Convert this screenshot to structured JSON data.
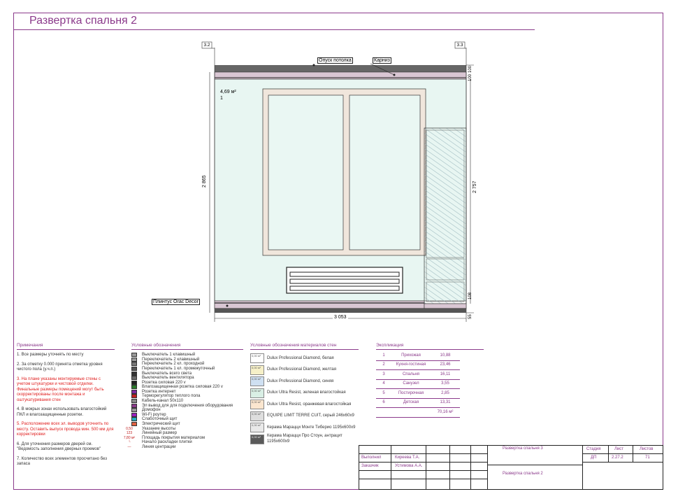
{
  "title": "Развертка спальня 2",
  "drawing": {
    "axis_left": "3.2",
    "axis_right": "3.3",
    "label_ceiling": "Опуск потолка",
    "label_cornice": "Карниз",
    "label_plinth": "Плинтус Orac Decor",
    "area": "4,69 м²",
    "area_index": "1",
    "dim_height": "2 865",
    "dim_width": "3 053",
    "dim_right_height": "2 757",
    "dim_top_100": "100",
    "dim_top_100b": "100",
    "dim_108": "108",
    "dim_55": "55",
    "colors": {
      "wall": "#e8f6f2",
      "band": "#d9c6d3",
      "frame": "#f0e6dc",
      "accent": "#8b3a8b"
    }
  },
  "notes": {
    "heading": "Примечания",
    "items": [
      {
        "text": "1. Все размеры уточнять по месту",
        "red": false
      },
      {
        "text": "2. За отметку 0.000 принята отметка уровня чистого пола  (у.ч.п.)",
        "red": false
      },
      {
        "text": "3. На плане указаны монтируемые стены с учетом штукатурки и чистовой отделки. Финальные размеры помещений могут быть скорректированы после монтажа и оштукатуривания стен",
        "red": true
      },
      {
        "text": "4. В мокрых зонах использовать влагостойкий ПКЛ и влагозащищенные розетки.",
        "red": false
      },
      {
        "text": "5. Расположение всех эл. выводов уточнить по месту. Оставить выпуск провода мин. 500 мм для корректировки",
        "red": true
      },
      {
        "text": "6. Для уточнения размеров дверей см. \"Ведомость заполнения дверных проемов\"",
        "red": false
      },
      {
        "text": "7. Количество всех элементов просчитано без запаса",
        "red": false
      }
    ]
  },
  "legend": {
    "heading": "Условные обозначения",
    "items": [
      {
        "label": "Выключатель 1 клавишный",
        "icon": "switch-1-icon",
        "color": "#999"
      },
      {
        "label": "Переключатель 2 клавишный",
        "icon": "switch-2-icon",
        "color": "#999"
      },
      {
        "label": "Переключатель 2 кл. проходной",
        "icon": "switch-pass-icon",
        "color": "#777"
      },
      {
        "label": "Переключатель 1 кл. промежуточный",
        "icon": "switch-mid-icon",
        "color": "#555"
      },
      {
        "label": "Выключатель всего света",
        "icon": "switch-all-icon",
        "color": "#333"
      },
      {
        "label": "Выключатель вентилятора",
        "icon": "fan-switch-icon",
        "color": "#666"
      },
      {
        "label": "Розетка силовая 220 v",
        "icon": "socket-icon",
        "color": "#222"
      },
      {
        "label": "Влагозащищенная розетка силовая 220 v",
        "icon": "wet-socket-icon",
        "color": "#2a7a2a"
      },
      {
        "label": "Розетка интернет",
        "icon": "lan-socket-icon",
        "color": "#7a2aa0"
      },
      {
        "label": "Терморегулятор теплого пола",
        "icon": "thermostat-icon",
        "color": "#c02020"
      },
      {
        "label": "Кабель-канал 50х110",
        "icon": "cable-channel-icon",
        "color": "#888"
      },
      {
        "label": "Эл вывод для для подключения оборудования",
        "icon": "power-outlet-icon",
        "color": "#8b3a8b"
      },
      {
        "label": "Домофон",
        "icon": "intercom-icon",
        "color": "#999"
      },
      {
        "label": "Wi-Fi роутер",
        "icon": "wifi-router-icon",
        "color": "#9a20c0"
      },
      {
        "label": "Слаботочный щит",
        "icon": "lowcurrent-panel-icon",
        "color": "#20b0c0"
      },
      {
        "label": "Электрический щит",
        "icon": "electric-panel-icon",
        "color": "#e06040"
      },
      {
        "label": "Указание высоты",
        "icon": "height-mark-icon",
        "color": "#c02020"
      },
      {
        "label": "Линейный размер",
        "icon": "linear-dim-icon",
        "color": "#c02020"
      },
      {
        "label": "Площадь покрытия материалом",
        "icon": "area-mark-icon",
        "color": "#c02020"
      },
      {
        "label": "Начало раскладки плитки",
        "icon": "tile-start-icon",
        "color": "#c02020"
      },
      {
        "label": "Линия центрации",
        "icon": "center-line-icon",
        "color": "#c02020"
      }
    ],
    "marks": {
      "h": "0,50",
      "dim": "123",
      "area": "7,80 м²"
    }
  },
  "materials": {
    "heading": "Условные обозначения материалов стен",
    "items": [
      {
        "label": "Dulux Professional Diamond, белая",
        "tag": "0,00 м²",
        "color": "#ffffff"
      },
      {
        "label": "Dulux Professional Diamond, желтая",
        "tag": "0,00 м²",
        "color": "#f6f0c8"
      },
      {
        "label": "Dulux Professional Diamond, синяя",
        "tag": "0,00 м²",
        "color": "#cfe0f2"
      },
      {
        "label": "Dulux Ultra Resist, зеленая влагостойкая",
        "tag": "0,00 м²",
        "color": "#d9efe5"
      },
      {
        "label": "Dulux Ultra Resist, оранжевая влагостойкая",
        "tag": "0,00 м²",
        "color": "#fbe6cf"
      },
      {
        "label": "EQUIPE LIMIT TERRE CUIT, серый 246х60х9",
        "tag": "0,00 м²",
        "color": "#dedede"
      },
      {
        "label": "Керама Марацци Монте Тиберио 1195х600х9",
        "tag": "0,00 м²",
        "color": "#e9e9e9"
      },
      {
        "label": "Керама Марацци Про Стоун, антрацит 1195х600х9",
        "tag": "0,00 м²",
        "color": "#5a5a5a"
      }
    ]
  },
  "explication": {
    "heading": "Экспликация",
    "rows": [
      {
        "n": "1",
        "name": "Прихожая",
        "area": "10,88"
      },
      {
        "n": "2",
        "name": "Кухня-гостиная",
        "area": "23,46"
      },
      {
        "n": "3",
        "name": "Спальня",
        "area": "16,11"
      },
      {
        "n": "4",
        "name": "Санузел",
        "area": "3,55"
      },
      {
        "n": "5",
        "name": "Постирочная",
        "area": "2,85"
      },
      {
        "n": "6",
        "name": "Детская",
        "area": "13,31"
      }
    ],
    "total": "70,16 м²"
  },
  "stamp": {
    "performed_label": "Выполнил",
    "performed_name": "Киреева Т.А.",
    "customer_label": "Заказчик",
    "customer_name": "Устимова А.А.",
    "sheet_title_top": "Развертка спальня 3",
    "sheet_title_bottom": "Развертка спальня 2",
    "stage_label": "Стадия",
    "sheet_label": "Лист",
    "sheets_label": "Листов",
    "stage": "ДП",
    "sheet": "2.27.2",
    "sheets": "71"
  }
}
